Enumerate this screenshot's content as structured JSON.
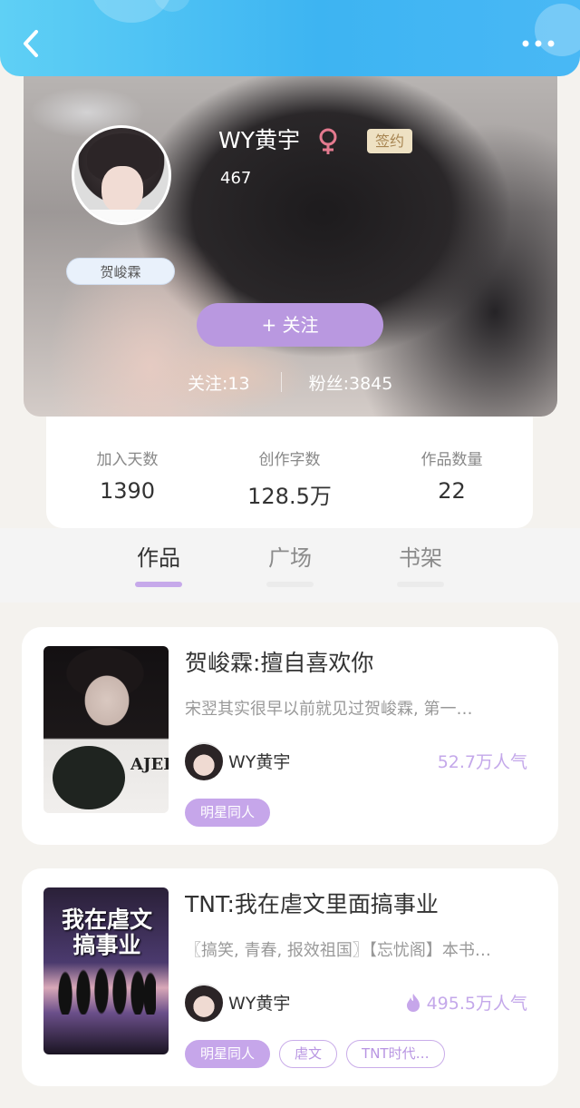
{
  "colors": {
    "header_start": "#5fd0f5",
    "header_end": "#49b8f5",
    "accent_purple": "#b998e0",
    "sign_badge_bg": "#eee1c3",
    "gender_color": "#e47a8f"
  },
  "header": {
    "back_icon": "chevron-left-icon",
    "more_icon": "more-dots-icon"
  },
  "profile": {
    "name": "WY黄宇",
    "gender_icon": "female-icon",
    "sign_label": "签约",
    "id": "467",
    "nickname": "贺峻霖",
    "follow_button": "+ 关注",
    "following": "关注:13",
    "fans": "粉丝:3845"
  },
  "stats": [
    {
      "label": "加入天数",
      "value": "1390"
    },
    {
      "label": "创作字数",
      "value": "128.5万"
    },
    {
      "label": "作品数量",
      "value": "22"
    }
  ],
  "tabs": [
    {
      "label": "作品",
      "active": true
    },
    {
      "label": "广场",
      "active": false
    },
    {
      "label": "书架",
      "active": false
    }
  ],
  "books": [
    {
      "title": "贺峻霖:擅自喜欢你",
      "desc": "宋翌其实很早以前就见过贺峻霖, 第一…",
      "author": "WY黄宇",
      "popularity": "52.7万人气",
      "cover_text": "AJEL",
      "tags": [
        "明星同人"
      ]
    },
    {
      "title": "TNT:我在虐文里面搞事业",
      "desc": "〖搞笑, 青春, 报效祖国〗【忘忧阁】本书…",
      "author": "WY黄宇",
      "popularity": "495.5万人气",
      "cover_text": "我在虐文搞事业",
      "tags": [
        "明星同人",
        "虐文",
        "TNT时代…"
      ]
    }
  ]
}
